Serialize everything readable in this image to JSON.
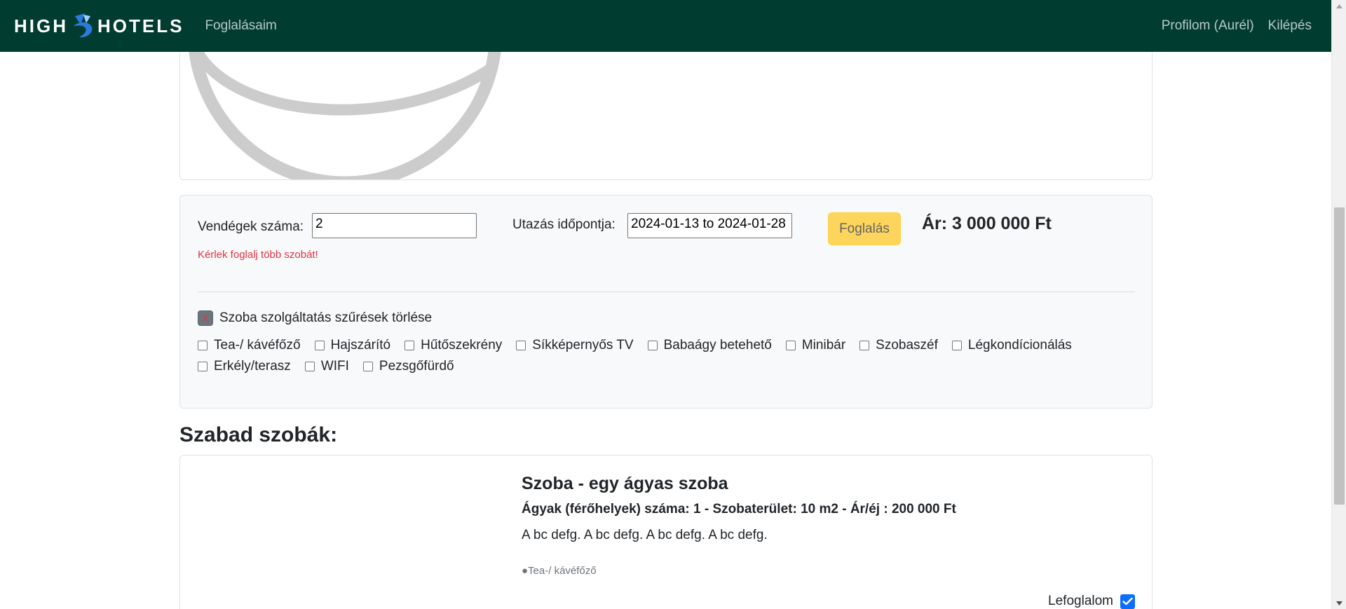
{
  "navbar": {
    "logo_left": "HIGH",
    "logo_right": "HOTELS",
    "my_bookings": "Foglalásaim",
    "profile": "Profilom (Aurél)",
    "logout": "Kilépés"
  },
  "booking": {
    "guests_label": "Vendégek száma:",
    "guests_value": "2",
    "error": "Kérlek foglalj több szobát!",
    "date_label": "Utazás időpontja:",
    "date_value": "2024-01-13 to 2024-01-28",
    "book_button": "Foglalás",
    "price": "Ár: 3 000 000 Ft",
    "clear_filters_mark": "X",
    "clear_filters_label": "Szoba szolgáltatás szűrések törlése",
    "filters": [
      "Tea-/ kávéfőző",
      "Hajszárító",
      "Hűtőszekrény",
      "Síkképernyős TV",
      "Babaágy betehető",
      "Minibár",
      "Szobaszéf",
      "Légkondícionálás",
      "Erkély/terasz",
      "WIFI",
      "Pezsgőfürdő"
    ]
  },
  "rooms_section": {
    "title": "Szabad szobák:"
  },
  "room": {
    "title": "Szoba - egy ágyas szoba",
    "meta": "Ágyak (férőhelyek) száma: 1 - Szobaterület: 10 m2 - Ár/éj : 200 000 Ft",
    "description": "A bc defg. A bc defg. A bc defg. A bc defg.",
    "amenity": "●Tea-/ kávéfőző",
    "reserve_label": "Lefoglalom",
    "reserve_checked": true
  },
  "colors": {
    "navbar": "#003c30",
    "button": "#ffd454",
    "error": "#dc3545",
    "checkbox_checked": "#0d6efd"
  },
  "icons": {
    "logo": "hotel-logo-icon",
    "clear": "clear-filter-icon",
    "check": "checkmark-icon",
    "image_placeholder": "loading-spinner-icon"
  }
}
